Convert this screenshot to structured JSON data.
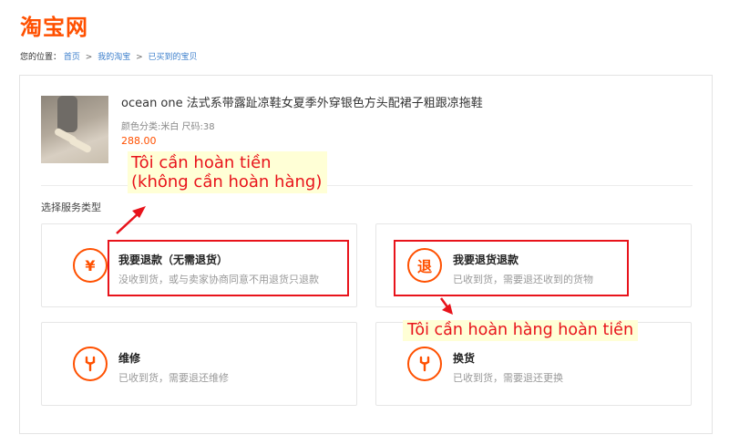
{
  "header": {
    "logo": "淘宝网"
  },
  "breadcrumb": {
    "prefix": "您的位置：",
    "items": [
      "首页",
      "我的淘宝",
      "已买到的宝贝"
    ],
    "separator": ">"
  },
  "product": {
    "title": "ocean one 法式系带露趾凉鞋女夏季外穿银色方头配裙子粗跟凉拖鞋",
    "sku": "颜色分类:米白   尺码:38",
    "price": "288.00"
  },
  "service": {
    "section_label": "选择服务类型",
    "options": [
      {
        "icon": "¥",
        "title": "我要退款（无需退货）",
        "desc": "没收到货，或与卖家协商同意不用退货只退款"
      },
      {
        "icon": "退",
        "title": "我要退货退款",
        "desc": "已收到货，需要退还收到的货物"
      },
      {
        "icon": "wrench",
        "title": "维修",
        "desc": "已收到货，需要退还维修"
      },
      {
        "icon": "wrench",
        "title": "换货",
        "desc": "已收到货，需要退还更换"
      }
    ]
  },
  "annotations": {
    "note1_line1": "Tôi cần hoàn tiền",
    "note1_line2": "(không cần hoàn hàng)",
    "note2": "Tôi cần hoàn hàng hoàn tiền",
    "color": "#e8131b"
  },
  "colors": {
    "brand": "#ff5000",
    "link": "#3c7fcc"
  }
}
